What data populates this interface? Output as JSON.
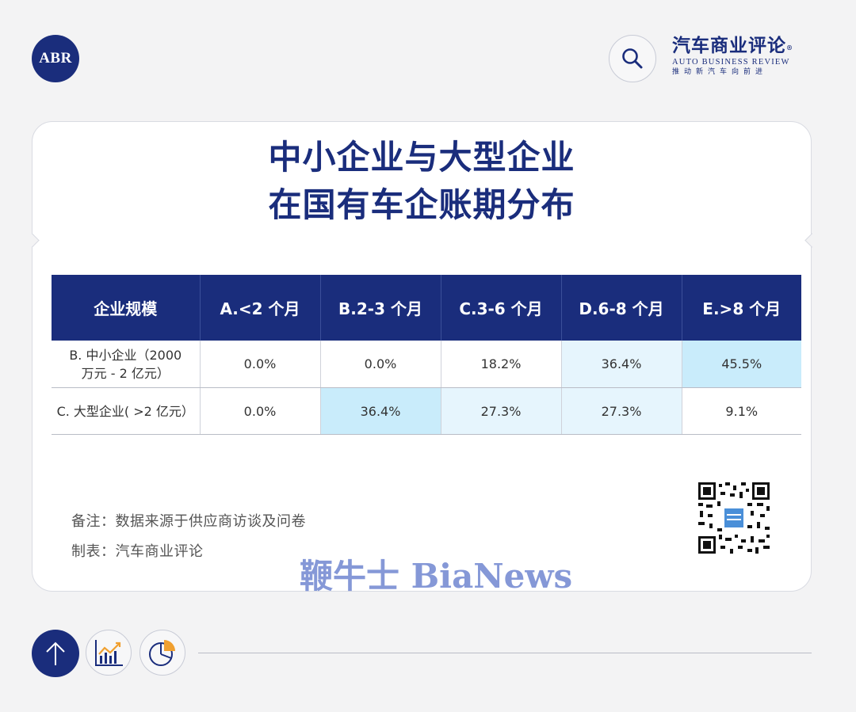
{
  "header": {
    "badge_text": "ABR",
    "brand_cn": "汽车商业评论",
    "brand_reg": "®",
    "brand_en": "AUTO BUSINESS REVIEW",
    "brand_tagline": "推动新汽车向前进"
  },
  "title_line1": "中小企业与大型企业",
  "title_line2": "在国有车企账期分布",
  "chart_data": {
    "type": "table",
    "columns": [
      "企业规模",
      "A.<2 个月",
      "B.2-3 个月",
      "C.3-6 个月",
      "D.6-8 个月",
      "E.>8 个月"
    ],
    "rows": [
      {
        "label_line1": "B. 中小企业（2000",
        "label_line2": "万元 - 2 亿元）",
        "values": [
          "0.0%",
          "0.0%",
          "18.2%",
          "36.4%",
          "45.5%"
        ],
        "numeric": [
          0.0,
          0.0,
          18.2,
          36.4,
          45.5
        ]
      },
      {
        "label_line1": "C. 大型企业( >2 亿元）",
        "label_line2": "",
        "values": [
          "0.0%",
          "36.4%",
          "27.3%",
          "27.3%",
          "9.1%"
        ],
        "numeric": [
          0.0,
          36.4,
          27.3,
          27.3,
          9.1
        ]
      }
    ],
    "colors": {
      "header": "#1a2d7c",
      "highlight_strong": "#c9ecfb",
      "highlight_light": "#e6f5fd"
    }
  },
  "notes": {
    "note1": "备注：数据来源于供应商访谈及问卷",
    "note2": "制表：汽车商业评论"
  },
  "watermark": "鞭牛士 BiaNews",
  "icons": [
    "search-icon",
    "arrow-up-icon",
    "line-chart-icon",
    "pie-chart-icon",
    "qr-code"
  ]
}
